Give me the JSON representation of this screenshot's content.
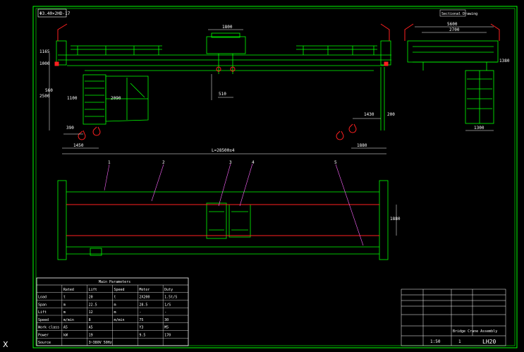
{
  "drawing": {
    "top_tag": "Φ3.40×2HD-17",
    "side_view_title": "Sectional Drawing",
    "dim_top_1800": "1800",
    "dim_1165": "1165",
    "dim_1000": "1000",
    "dim_1100": "1100",
    "dim_2090": "2090",
    "dim_3000": "3000",
    "dim_560": "560",
    "dim_2500": "2500",
    "dim_510": "510",
    "dim_390": "390",
    "dim_1450": "1450",
    "dim_1430": "1430",
    "dim_200": "200",
    "dim_1880": "1880",
    "dim_span": "L=28500±4",
    "dim_side_5600": "5600",
    "dim_side_2700": "2700",
    "dim_side_1380": "1380",
    "dim_side_1300": "1300",
    "dim_1880_right": "1880",
    "dim_1800_right": "1800",
    "callouts": [
      "1",
      "2",
      "3",
      "4",
      "5"
    ],
    "corner_mark": "X"
  },
  "parameter_table": {
    "title": "Main Parameters",
    "header": [
      "",
      "Rated",
      "Lift",
      "Speed",
      "Motor",
      "Duty"
    ],
    "rows": [
      [
        "Load",
        "t",
        "20",
        "t",
        "2X200",
        "1.5t/S"
      ],
      [
        "Span",
        "m",
        "22.5",
        "m",
        "28.5",
        "1/S"
      ],
      [
        "Lift",
        "m",
        "12",
        "m",
        "-",
        "-"
      ],
      [
        "Speed",
        "m/min",
        "8",
        "m/min",
        "75",
        "30"
      ],
      [
        "Work class",
        "A5",
        "A5",
        "",
        "Y3",
        "M5"
      ],
      [
        "Power",
        "kW",
        "19",
        "",
        "9.5",
        "170"
      ],
      [
        "Source",
        "",
        "3~380V 50Hz",
        "",
        "",
        ""
      ]
    ]
  },
  "title_block": {
    "project": "Bridge Crane Assembly",
    "drawing_no": "LH20",
    "scale": "1:50",
    "sheet": "1"
  }
}
